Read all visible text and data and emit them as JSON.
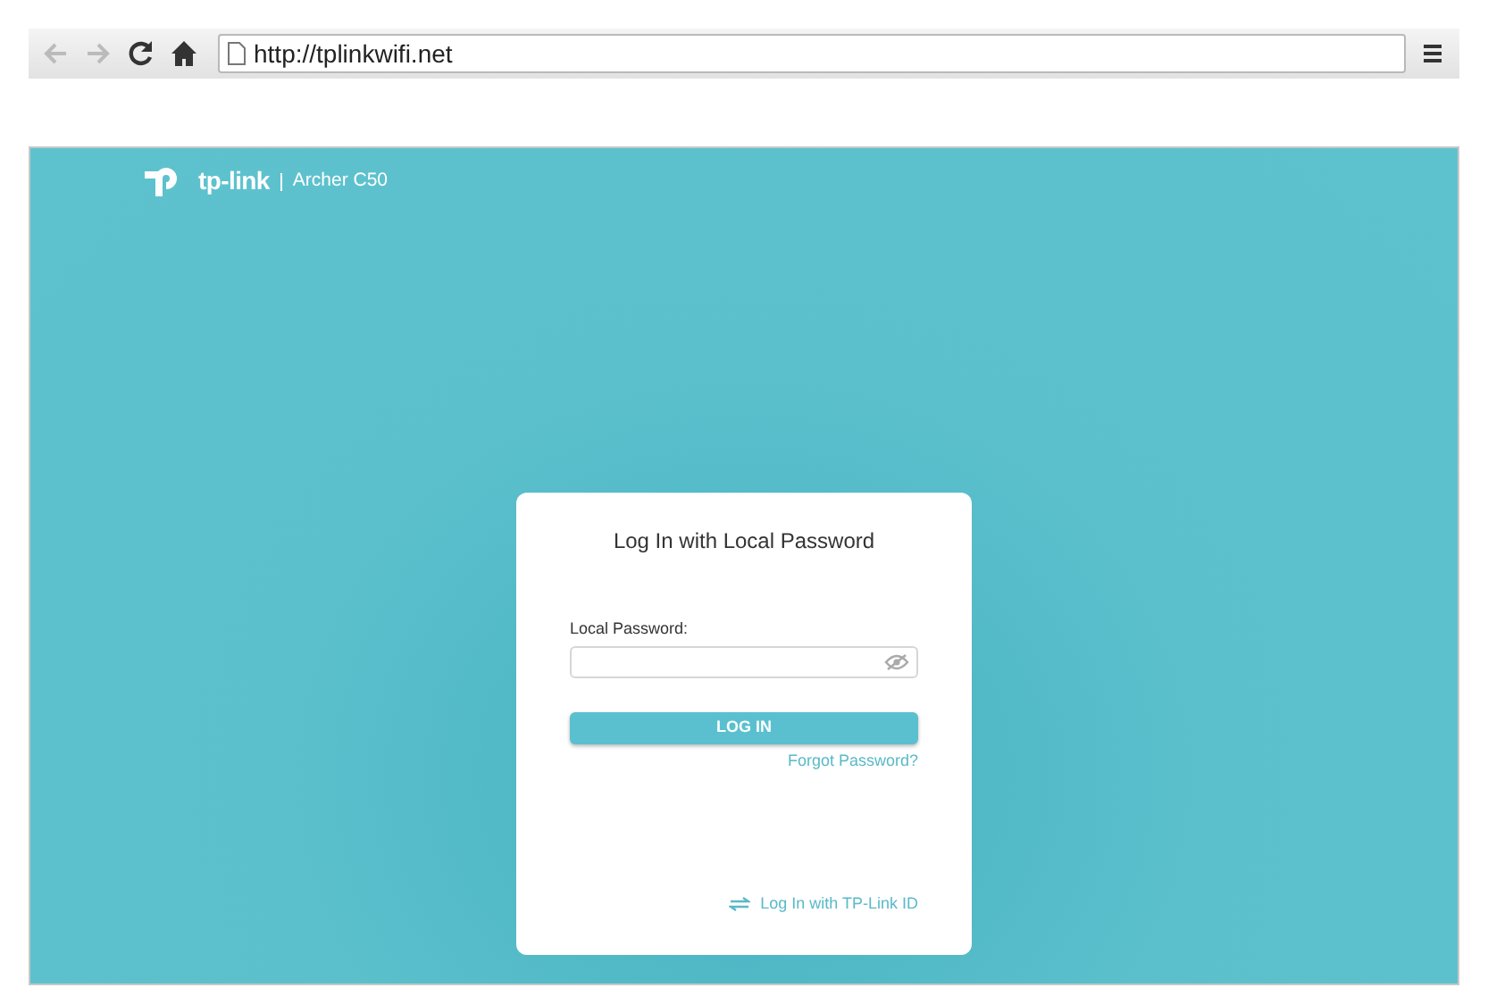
{
  "browser": {
    "back_disabled": true,
    "forward_disabled": true,
    "url": "http://tplinkwifi.net"
  },
  "header": {
    "brand": "tp-link",
    "model": "Archer C50"
  },
  "login": {
    "title": "Log In with Local Password",
    "field_label": "Local Password:",
    "password_visible": false,
    "button": "LOG IN",
    "forgot": "Forgot Password?",
    "alt_login": "Log In with TP-Link ID"
  }
}
